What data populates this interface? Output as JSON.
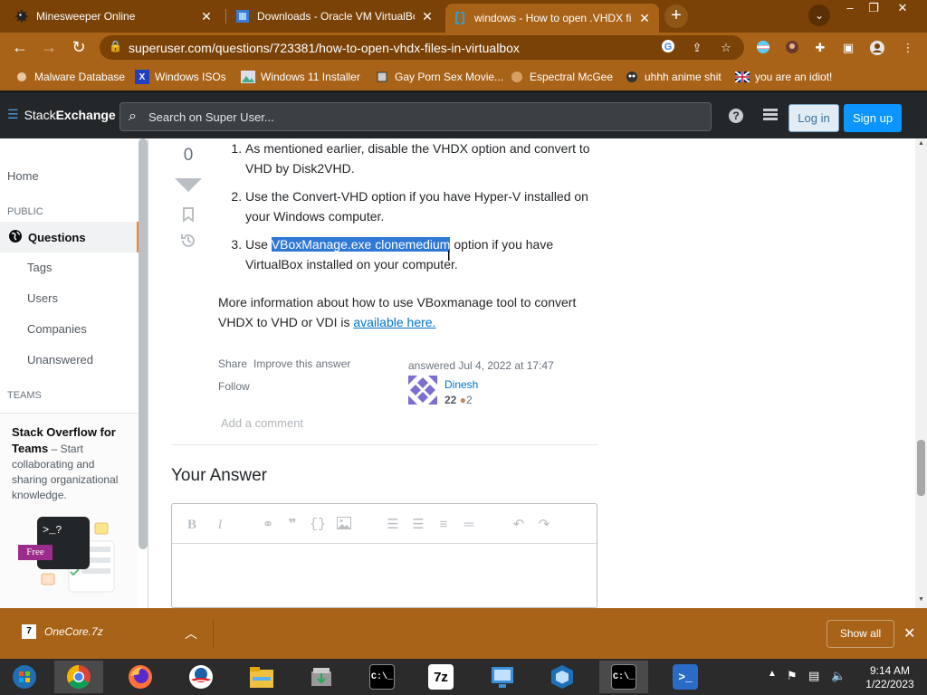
{
  "browser": {
    "tabs": [
      {
        "title": "Minesweeper Online",
        "active": false
      },
      {
        "title": "Downloads - Oracle VM VirtualBox",
        "active": false
      },
      {
        "title": "windows - How to open .VHDX file",
        "active": true
      }
    ],
    "url": "superuser.com/questions/723381/how-to-open-vhdx-files-in-virtualbox",
    "bookmarks": [
      "Malware Database",
      "Windows ISOs",
      "Windows 11 Installer",
      "Gay Porn Sex Movie...",
      "Espectral McGee",
      "uhhh anime shit",
      "you are an idiot!"
    ]
  },
  "se_header": {
    "logo_stack": "Stack",
    "logo_exchange": "Exchange",
    "search_placeholder": "Search on Super User...",
    "login": "Log in",
    "signup": "Sign up"
  },
  "leftnav": {
    "home": "Home",
    "public": "PUBLIC",
    "questions": "Questions",
    "tags": "Tags",
    "users": "Users",
    "companies": "Companies",
    "unanswered": "Unanswered",
    "teams": "TEAMS",
    "teams_title": "Stack Overflow for Teams",
    "teams_desc": " – Start collaborating and sharing organizational knowledge.",
    "free_badge": "Free"
  },
  "answer": {
    "vote_count": "0",
    "items": [
      {
        "text": "As mentioned earlier, disable the VHDX option and convert to VHD by Disk2VHD."
      },
      {
        "text": "Use the Convert-VHD option if you have Hyper-V installed on your Windows computer."
      },
      {
        "pre": "Use ",
        "highlight": "VBoxManage.exe clonemedium",
        "post": " option if you have VirtualBox installed on your computer."
      }
    ],
    "more_text": "More information about how to use VBoxmanage tool to convert VHDX to VHD or VDI is ",
    "more_link": "available here.",
    "share": "Share",
    "improve": "Improve this answer",
    "follow": "Follow",
    "answered": "answered Jul 4, 2022 at 17:47",
    "user_name": "Dinesh",
    "user_rep": "22",
    "user_badges": "2",
    "add_comment": "Add a comment"
  },
  "your_answer": {
    "heading": "Your Answer"
  },
  "downloads": {
    "file": "OneCore.7z",
    "show_all": "Show all"
  },
  "taskbar": {
    "time": "9:14 AM",
    "date": "1/22/2023"
  },
  "colors": {
    "chrome_dark": "#7a4207",
    "chrome": "#a86318",
    "se_bar": "#242729",
    "accent_orange": "#f48225",
    "link_blue": "#0074cc",
    "selection": "#2f78d4"
  }
}
